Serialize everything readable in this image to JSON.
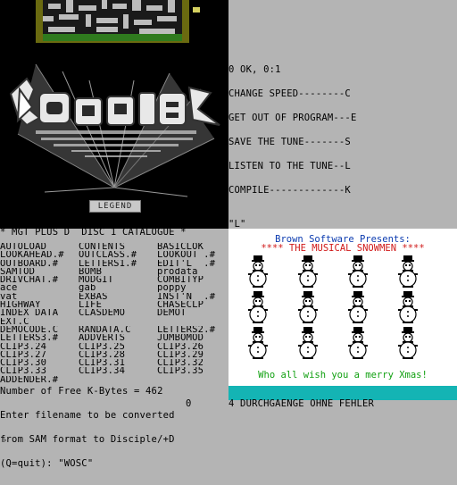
{
  "menu": {
    "lines": [
      "0 OK, 0:1",
      "CHANGE SPEED--------C",
      "GET OUT OF PROGRAM---E",
      "SAVE THE TUNE-------S",
      "LISTEN TO THE TUNE--L",
      "COMPILE-------------K"
    ]
  },
  "logo": {
    "badge": "LEGEND"
  },
  "quote_indicator": "\"L\"",
  "catalogue": {
    "title": "* MGT PLUS D  DISC 1 CATALOGUE *",
    "rows": [
      [
        "AUTOLOAD",
        "CONTENTS",
        "BASICLOK"
      ],
      [
        "LOOKAHEAD.#",
        "OUTCLASS.#",
        "LOOKOUT .#"
      ],
      [
        "OUTBOARD.#",
        "LETTERS1.#",
        "EDIT'L  .#"
      ],
      [
        "SAMTOD",
        "BOMB",
        "prodata"
      ],
      [
        "DRIVCHAT.#",
        "MODGIT",
        "COMBITYP"
      ],
      [
        "ace",
        "gab",
        "poppy"
      ],
      [
        "vat",
        "EXBAS",
        "INST'N  .#"
      ],
      [
        "HIGHWAY",
        "LIFE",
        "CHASECLP"
      ],
      [
        "INDEX DATA",
        "CLASDEMO",
        "DEMOT"
      ],
      [
        "EXT.C",
        "",
        ""
      ],
      [
        "DEMOCODE.C",
        "RANDATA.C",
        "LETTERS2.#"
      ],
      [
        "LETTERS3.#",
        "ADDVERTS",
        "JUMBOMOD"
      ],
      [
        "CLIP3.24",
        "CLIP3.25",
        "CLIP3.26"
      ],
      [
        "CLIP3.27",
        "CLIP3.28",
        "CLIP3.29"
      ],
      [
        "CLIP3.30",
        "CLIP3.31",
        "CLIP3.32"
      ],
      [
        "CLIP3.33",
        "CLIP3.34",
        "CLIP3.35"
      ],
      [
        "ADDENDER.#",
        "",
        ""
      ]
    ],
    "footer": [
      "Number of Free K-Bytes = 462",
      "Enter filename to be converted",
      "from SAM format to Disciple/+D",
      "(Q=quit): \"WOSC\""
    ]
  },
  "snowmen": {
    "title": "Brown Software Presents:",
    "subtitle": "**** THE MUSICAL SNOWMEN ****",
    "footer": "Who all wish you a merry Xmas!",
    "count": 12
  },
  "status": {
    "zero": "0",
    "text": "4 DURCHGAENGE OHNE FEHLER"
  },
  "prompt": "›",
  "colors": {
    "background": "#b4b4b4",
    "snow_title": "#0b3bb0",
    "snow_subtitle": "#d01818",
    "snow_footer": "#10a010",
    "cyan_bar": "#14b4b4",
    "maze_floor": "#2f7a1e"
  }
}
